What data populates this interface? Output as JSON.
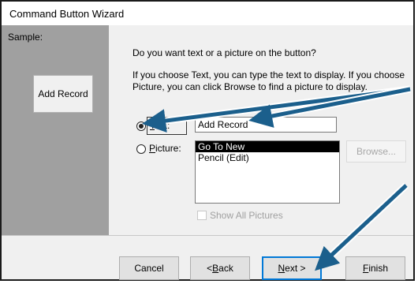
{
  "window": {
    "title": "Command Button Wizard"
  },
  "sample": {
    "label": "Sample:",
    "button_text": "Add Record"
  },
  "main": {
    "question": "Do you want text or a picture on the button?",
    "description": "If you choose Text, you can type the text to display.  If you choose Picture, you can click Browse to find a picture to display."
  },
  "options": {
    "text_label_key": "T",
    "text_label_rest": "ext:",
    "text_selected": true,
    "text_value": "Add Record",
    "picture_label_key": "P",
    "picture_label_rest": "icture:",
    "picture_selected": false
  },
  "picture_list": {
    "items": [
      "Go To New",
      "Pencil (Edit)"
    ],
    "selected_index": 0
  },
  "browse_button": {
    "label": "Browse..."
  },
  "show_all": {
    "label": "Show All Pictures",
    "checked": false
  },
  "buttons": {
    "cancel": "Cancel",
    "back_prefix": "< ",
    "back_key": "B",
    "back_rest": "ack",
    "next_key": "N",
    "next_rest": "ext >",
    "finish_key": "F",
    "finish_rest": "inish"
  },
  "annotation_color": "#1b5f8c",
  "colors": {
    "sample_panel": "#a0a0a0",
    "focus_border": "#0078d7"
  }
}
